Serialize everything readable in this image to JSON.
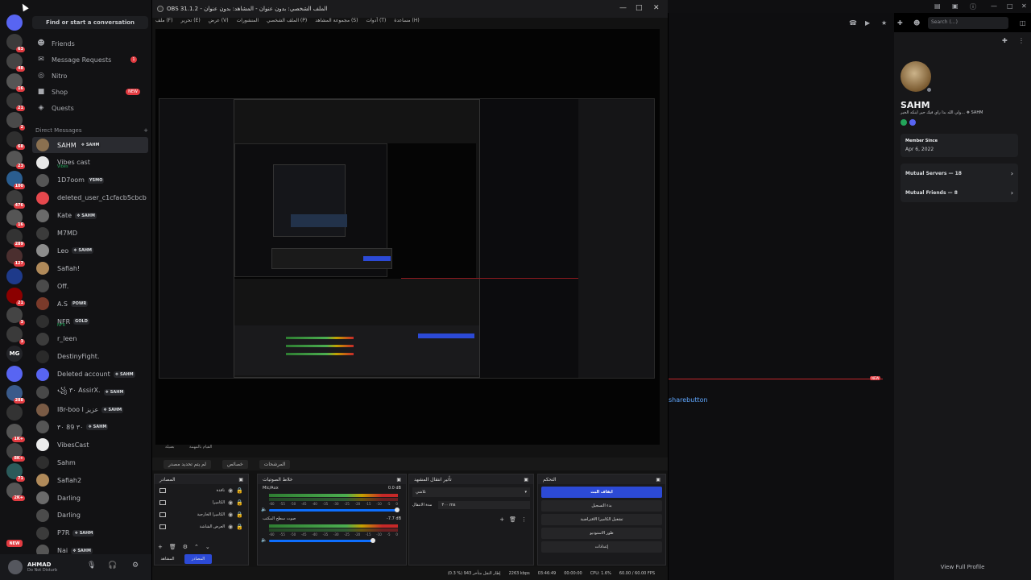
{
  "discord": {
    "search_button": "Find or start a conversation",
    "nav": [
      {
        "label": "Friends",
        "icon": "friends-icon"
      },
      {
        "label": "Message Requests",
        "icon": "mail-icon",
        "count": "1"
      },
      {
        "label": "Nitro",
        "icon": "nitro-icon"
      },
      {
        "label": "Shop",
        "icon": "shop-icon",
        "badge": "NEW"
      },
      {
        "label": "Quests",
        "icon": "quests-icon"
      }
    ],
    "dm_header": "Direct Messages",
    "dm_add": "+",
    "dms": [
      {
        "name": "SAHM",
        "tag": "❖ SAHM",
        "color": "#8a7050",
        "active": true
      },
      {
        "name": "Vibes cast",
        "sub": "Vibes",
        "color": "#e8e8e8"
      },
      {
        "name": "1D7oom",
        "tag": "YSMO",
        "color": "#555"
      },
      {
        "name": "deleted_user_c1cfacb5cbcb",
        "color": "#e5484d"
      },
      {
        "name": "Kate",
        "tag": "❖ SAHM",
        "color": "#6a6a6a"
      },
      {
        "name": "M7MD",
        "color": "#3b3b3b"
      },
      {
        "name": "Leo",
        "tag": "❖ SAHM",
        "color": "#8c8c8c"
      },
      {
        "name": "Safiah!",
        "color": "#b08a5a"
      },
      {
        "name": "Off.",
        "color": "#4a4a4a"
      },
      {
        "name": "A.S",
        "tag": "POWR",
        "color": "#7a3a2a"
      },
      {
        "name": "NFR",
        "tag": "GOLD",
        "sub": "NFR",
        "color": "#2f2f2f"
      },
      {
        "name": "r_leen",
        "color": "#3c3c3c"
      },
      {
        "name": "DestinyFight.",
        "color": "#2a2a2a"
      },
      {
        "name": "Deleted account",
        "tag": "❖ SAHM",
        "color": "#5865f2"
      },
      {
        "name": "꧁ ٣٠ AssirX.",
        "tag": "❖ SAHM",
        "color": "#484848"
      },
      {
        "name": "I8r-boo I عزيز",
        "tag": "❖ SAHM",
        "color": "#7a5b45"
      },
      {
        "name": "٣٠ 89 ٣٠",
        "tag": "❖ SAHM",
        "color": "#555"
      },
      {
        "name": "VibesCast",
        "color": "#ececec"
      },
      {
        "name": "Sahm",
        "color": "#2e2e2e"
      },
      {
        "name": "Safiah2",
        "color": "#b08a5a"
      },
      {
        "name": "Darling",
        "color": "#6a6a6a"
      },
      {
        "name": "Darling",
        "color": "#4b4b4b"
      },
      {
        "name": "P7R",
        "tag": "❖ SAHM",
        "color": "#3b3b3b"
      },
      {
        "name": "Nai",
        "tag": "❖ SAHM",
        "color": "#555"
      }
    ],
    "user": {
      "name": "AHMAD",
      "status": "Do Not Disturb"
    },
    "servers": [
      {
        "label": "",
        "color": "#5865f2",
        "badge": ""
      },
      {
        "label": "",
        "color": "#3b3b3b",
        "badge": "63"
      },
      {
        "label": "",
        "color": "#444",
        "badge": "48"
      },
      {
        "label": "",
        "color": "#555",
        "badge": "16"
      },
      {
        "label": "",
        "color": "#383838",
        "badge": "21"
      },
      {
        "label": "",
        "color": "#4a4a4a",
        "badge": "2"
      },
      {
        "label": "",
        "color": "#2f2f2f",
        "badge": "68"
      },
      {
        "label": "",
        "color": "#555",
        "badge": "23"
      },
      {
        "label": "",
        "color": "#2a5d8f",
        "badge": "100"
      },
      {
        "label": "",
        "color": "#3c3c3c",
        "badge": "476"
      },
      {
        "label": "",
        "color": "#555",
        "badge": "16"
      },
      {
        "label": "",
        "color": "#333",
        "badge": "289"
      },
      {
        "label": "",
        "color": "#4b2f2f",
        "badge": "127"
      },
      {
        "label": "",
        "color": "#1e3a8a",
        "badge": ""
      },
      {
        "label": "",
        "color": "#8b0000",
        "badge": "21"
      },
      {
        "label": "",
        "color": "#444",
        "badge": "3"
      },
      {
        "label": "",
        "color": "#3a3a3a",
        "badge": "3"
      },
      {
        "label": "MG",
        "color": "#232428",
        "badge": ""
      },
      {
        "label": "",
        "color": "#5865f2",
        "badge": ""
      },
      {
        "label": "",
        "color": "#3a5a8a",
        "badge": "288"
      },
      {
        "label": "",
        "color": "#333",
        "badge": ""
      },
      {
        "label": "",
        "color": "#555",
        "badge": "1K+"
      },
      {
        "label": "",
        "color": "#444",
        "badge": "8K+"
      },
      {
        "label": "",
        "color": "#2b5a5a",
        "badge": "71"
      },
      {
        "label": "",
        "color": "#555",
        "badge": "2K+"
      }
    ],
    "rail_new": "NEW",
    "search_placeholder": "Search (...)",
    "profile": {
      "name": "SAHM",
      "tagline": "ولي الله بذا راي فيك حير اينكه الخير... ❖ SAHM",
      "member_since_label": "Member Since",
      "member_since": "Apr 6, 2022",
      "mutual_servers": "Mutual Servers — 18",
      "mutual_friends": "Mutual Friends — 8",
      "view_full": "View Full Profile"
    },
    "share_text": "sharebutton",
    "new_tag": "NEW"
  },
  "obs": {
    "title": "OBS 31.1.2 - الملف الشخصي: بدون عنوان - المشاهد: بدون عنوان",
    "menu": [
      "ملف (F)",
      "تحرير (E)",
      "عرض (V)",
      "المنشورات",
      "الملف الشخصي (P)",
      "مجموعة المشاهد (S)",
      "أدوات (T)",
      "مساعدة (H)"
    ],
    "scene_bar": "القيام بالمهمة",
    "scene_bar_left": "بصيلة",
    "ctx_buttons": [
      "لم يتم تحديد مصدر",
      "خصائص",
      "المرشحات"
    ],
    "docks": {
      "sources": {
        "title": "المصادر",
        "rows": [
          "نافذة",
          "الكاميرا",
          "الكاميرا الخارجية",
          "العرض الشاشة"
        ]
      },
      "mixer": {
        "title": "خلاط الصوتيات",
        "channels": [
          {
            "name": "Mic/Aux",
            "db": "0.0 dB"
          },
          {
            "name": "صوت سطح المكتب",
            "db": "-7.7 dB"
          }
        ],
        "scale": [
          "-60",
          "-55",
          "-50",
          "-45",
          "-40",
          "-35",
          "-30",
          "-25",
          "-20",
          "-15",
          "-10",
          "-5",
          "0"
        ]
      },
      "transitions": {
        "title": "تأثير انتقال المشهد",
        "type": "تلاشي",
        "duration_label": "مدة الانتقال",
        "duration": "٣٠٠ ms"
      },
      "controls": {
        "title": "التحكم",
        "buttons": [
          "ايقاف البث",
          "بدء التسجيل",
          "تشغيل الكاميرا الافتراضية",
          "طور الاستوديو",
          "إعدادات"
        ]
      }
    },
    "tabs": [
      "المشاهد",
      "المصادر"
    ],
    "status": {
      "dropped": "(0.3 %) 943 إطار النقل متأخر",
      "kbps": "2263 kbps",
      "stream_time": "03:46:49",
      "rec_time": "00:00:00",
      "cpu": "CPU: 1.6%",
      "fps": "60.00 / 60.00 FPS"
    }
  }
}
